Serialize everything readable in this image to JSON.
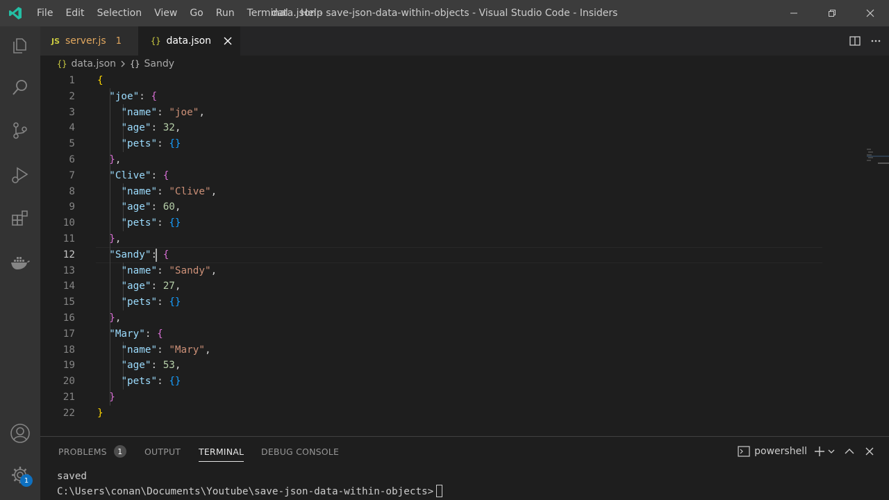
{
  "title_bar": {
    "menu": [
      "File",
      "Edit",
      "Selection",
      "View",
      "Go",
      "Run",
      "Terminal",
      "Help"
    ],
    "window_title": "data.json - save-json-data-within-objects - Visual Studio Code - Insiders"
  },
  "activity_bar": {
    "items": [
      "explorer-icon",
      "search-icon",
      "source-control-icon",
      "run-debug-icon",
      "extensions-icon",
      "docker-icon"
    ],
    "bottom": [
      "account-icon",
      "settings-icon"
    ],
    "settings_badge": "1"
  },
  "tabs": [
    {
      "icon": "JS",
      "label": "server.js",
      "problems": "1",
      "active": false
    },
    {
      "icon": "{}",
      "label": "data.json",
      "active": true
    }
  ],
  "breadcrumb": {
    "file": "data.json",
    "symbol": "Sandy",
    "icon_glyph": "{}"
  },
  "editor": {
    "active_line": 12,
    "lines": [
      "{",
      "  \"joe\": {",
      "    \"name\": \"joe\",",
      "    \"age\": 32,",
      "    \"pets\": {}",
      "  },",
      "  \"Clive\": {",
      "    \"name\": \"Clive\",",
      "    \"age\": 60,",
      "    \"pets\": {}",
      "  },",
      "  \"Sandy\": {",
      "    \"name\": \"Sandy\",",
      "    \"age\": 27,",
      "    \"pets\": {}",
      "  },",
      "  \"Mary\": {",
      "    \"name\": \"Mary\",",
      "    \"age\": 53,",
      "    \"pets\": {}",
      "  }",
      "}"
    ]
  },
  "panel": {
    "tabs": [
      {
        "label": "PROBLEMS",
        "badge": "1"
      },
      {
        "label": "OUTPUT"
      },
      {
        "label": "TERMINAL",
        "active": true
      },
      {
        "label": "DEBUG CONSOLE"
      }
    ],
    "terminal_name": "powershell",
    "terminal_lines": [
      "saved",
      "C:\\Users\\conan\\Documents\\Youtube\\save-json-data-within-objects>"
    ]
  },
  "colors": {
    "accent": "#007acc",
    "json_key": "#9cdcfe",
    "json_string": "#ce9178",
    "json_number": "#b5cea8",
    "bracket_level1": "#ffd700",
    "bracket_level2": "#da70d6",
    "js_icon": "#cbcb41"
  }
}
